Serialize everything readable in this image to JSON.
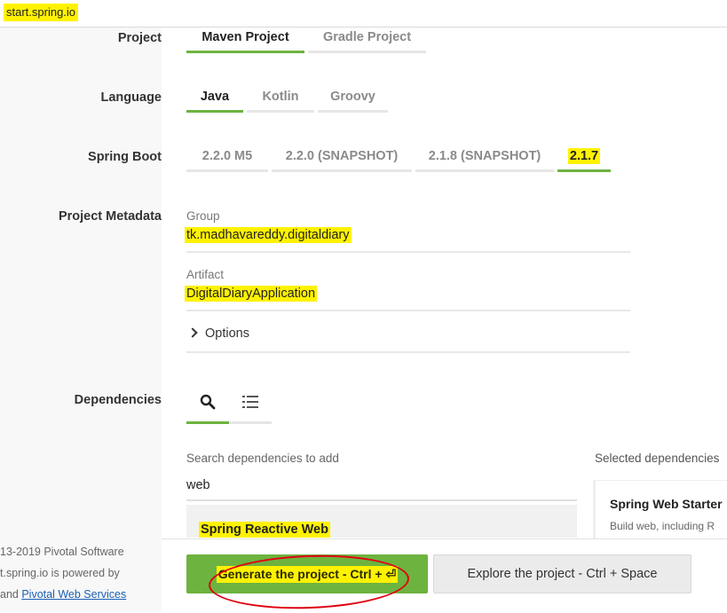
{
  "browser": {
    "url": "start.spring.io"
  },
  "sections": {
    "project": "Project",
    "language": "Language",
    "spring_boot": "Spring Boot",
    "metadata": "Project Metadata",
    "dependencies": "Dependencies"
  },
  "project_tabs": [
    "Maven Project",
    "Gradle Project"
  ],
  "language_tabs": [
    "Java",
    "Kotlin",
    "Groovy"
  ],
  "boot_tabs": [
    "2.2.0 M5",
    "2.2.0 (SNAPSHOT)",
    "2.1.8 (SNAPSHOT)",
    "2.1.7"
  ],
  "selected": {
    "project": "Maven Project",
    "language": "Java",
    "boot": "2.1.7"
  },
  "metadata": {
    "group_label": "Group",
    "group_value": "tk.madhavareddy.digitaldiary",
    "artifact_label": "Artifact",
    "artifact_value": "DigitalDiaryApplication",
    "options_label": "Options"
  },
  "dependencies": {
    "tabs": [
      "search-icon",
      "list-icon"
    ],
    "search_label": "Search dependencies to add",
    "search_value": "web",
    "results": [
      "Spring Reactive Web"
    ],
    "selected_label": "Selected dependencies",
    "selected_items": [
      {
        "name": "Spring Web Starter",
        "description": "Build web, including R"
      }
    ]
  },
  "footer": {
    "line1": "13-2019 Pivotal Software",
    "line2": "t.spring.io is powered by",
    "line3_prefix": "and ",
    "line3_link": "Pivotal Web Services"
  },
  "actions": {
    "generate_label": "Generate the project - Ctrl + ⏎",
    "explore_label": "Explore the project - Ctrl + Space"
  },
  "colors": {
    "accent": "#6db33f",
    "highlight": "#fff200",
    "annotation": "#e0000f"
  }
}
